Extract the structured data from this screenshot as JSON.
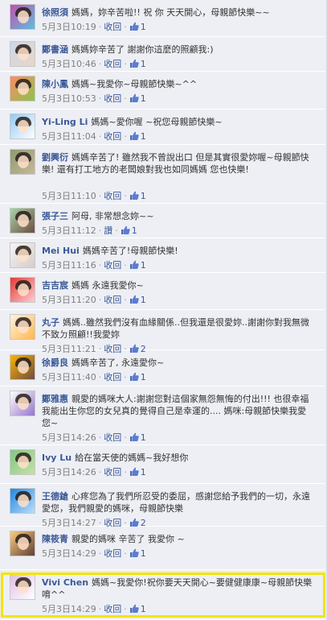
{
  "labels": {
    "reply": "收回"
  },
  "colors": {
    "name_link": "#3b5998",
    "background": "#edeff4",
    "highlight_border": "#f2e500"
  },
  "comments": [
    {
      "author": "徐照須",
      "text": "媽媽，妳辛苦啦!! 祝 你 天天開心，母親節快樂~~",
      "date": "5月3日10:19",
      "reply": "收回",
      "likes": "1",
      "avatar": {
        "colors": [
          "#c24fb0",
          "#5bc0de"
        ]
      }
    },
    {
      "author": "鄭書涵",
      "text": "媽媽妳辛苦了 謝謝你這麼的照顧我:)",
      "date": "5月3日10:46",
      "reply": "收回",
      "likes": "1",
      "avatar": {
        "colors": [
          "#ccd8e8",
          "#e8d6c8"
        ]
      }
    },
    {
      "author": "陳小鳳",
      "text": "媽媽~我愛你~母親節快樂~^^",
      "date": "5月3日10:53",
      "reply": "收回",
      "likes": "1",
      "avatar": {
        "colors": [
          "#ff8a65",
          "#8bc34a"
        ]
      }
    },
    {
      "author": "Yi-Ling Li",
      "text": "媽媽~愛你喔 ~祝您母親節快樂~",
      "date": "5月3日11:04",
      "reply": "收回",
      "likes": "1",
      "avatar": {
        "colors": [
          "#90caf9",
          "#ffffff"
        ]
      }
    },
    {
      "author": "劉興衍",
      "text": "媽媽辛苦了! 雖然我不曾說出口 但是其實很愛妳喔~母親節快樂! 還有打工地方的老闆娘對我也如同媽媽 您也快樂!",
      "date": "5月3日11:10",
      "reply": "收回",
      "likes": "1",
      "avatar": {
        "colors": [
          "#8d9a6e",
          "#c8b89a"
        ]
      }
    },
    {
      "author": "張子三",
      "text": "阿母, 非常想念妳~~",
      "date": "5月3日11:12",
      "reply": "讚",
      "likes": "1",
      "avatar": {
        "colors": [
          "#a5d6a7",
          "#6d4c41"
        ]
      }
    },
    {
      "author": "Mei Hui",
      "text": "媽媽辛苦了!母親節快樂!",
      "date": "5月3日11:16",
      "reply": "收回",
      "likes": "1",
      "avatar": {
        "colors": [
          "#f5f5f5",
          "#d7ccc8"
        ]
      }
    },
    {
      "author": "吉吉宸",
      "text": "媽媽 永遠我愛你~",
      "date": "5月3日11:20",
      "reply": "收回",
      "likes": "1",
      "avatar": {
        "colors": [
          "#e53935",
          "#ffcdd2"
        ]
      }
    },
    {
      "author": "丸子",
      "text": "媽媽..雖然我們沒有血緣關係..但我還是很愛妳..謝謝你對我無微不致ㄉ照顧!!我愛妳",
      "date": "5月3日11:21",
      "reply": "收回",
      "likes": "2",
      "avatar": {
        "colors": [
          "#fff3e0",
          "#ffb74d"
        ]
      }
    },
    {
      "author": "徐爵良",
      "text": "媽媽辛苦了, 永遠愛你~",
      "date": "5月3日11:40",
      "reply": "收回",
      "likes": "1",
      "avatar": {
        "colors": [
          "#ffb300",
          "#6d4c41"
        ]
      }
    },
    {
      "author": "鄭雅惠",
      "text": "親愛的媽咪大人:謝謝您對這個家無怨無悔的付出!!! 也很幸福我能出生你您的女兒真的覺得自己是幸運的.... 媽咪:母親節快樂我愛您~",
      "date": "5月3日14:26",
      "reply": "收回",
      "likes": "1",
      "avatar": {
        "colors": [
          "#ffffff",
          "#9575cd"
        ]
      }
    },
    {
      "author": "Ivy Lu",
      "text": "給在當天使的媽媽~我好想你",
      "date": "5月3日14:26",
      "reply": "收回",
      "likes": "1",
      "avatar": {
        "colors": [
          "#81c784",
          "#c5e1a5"
        ]
      }
    },
    {
      "author": "王德鎗",
      "text": "心疼您為了我們所忍受的委屈，感謝您給予我們的一切，永遠愛您，我們親愛的媽咪，母親節快樂",
      "date": "5月3日14:27",
      "reply": "收回",
      "likes": "2",
      "avatar": {
        "colors": [
          "#1e88e5",
          "#bbdefb"
        ]
      }
    },
    {
      "author": "陳筱青",
      "text": "親愛的媽咪 辛苦了 我愛你 ~",
      "date": "5月3日14:29",
      "reply": "收回",
      "likes": "1",
      "avatar": {
        "colors": [
          "#ffcc80",
          "#5d4037"
        ]
      }
    },
    {
      "author": "Vivi Chen",
      "text": "媽媽~我愛你!祝你要天天開心~要健健康康~母親節快樂唷^^",
      "date": "5月3日14:29",
      "reply": "收回",
      "likes": "1",
      "avatar": {
        "colors": [
          "#e1bee7",
          "#ffffff"
        ]
      }
    }
  ]
}
